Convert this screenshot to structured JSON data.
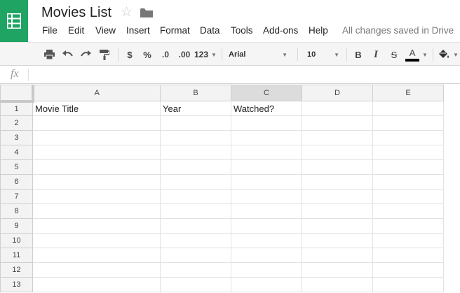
{
  "header": {
    "title": "Movies List",
    "save_status": "All changes saved in Drive",
    "menu": [
      "File",
      "Edit",
      "View",
      "Insert",
      "Format",
      "Data",
      "Tools",
      "Add-ons",
      "Help"
    ]
  },
  "toolbar": {
    "currency": "$",
    "percent": "%",
    "decrease_decimals": ".0",
    "increase_decimals": ".00",
    "more_formats": "123",
    "font": "Arial",
    "font_size": "10",
    "bold": "B",
    "italic": "I",
    "strikethrough": "S",
    "text_color": "A",
    "text_color_value": "#000000"
  },
  "formula_bar": {
    "label": "fx",
    "value": ""
  },
  "colors": {
    "brand_green": "#1fa463",
    "header_bg": "#f3f3f3",
    "selected_header_bg": "#dcdcdc"
  },
  "sheet": {
    "columns": [
      "A",
      "B",
      "C",
      "D",
      "E"
    ],
    "selected_column": "C",
    "rows": [
      {
        "num": "1",
        "cells": [
          "Movie Title",
          "Year",
          "Watched?",
          "",
          ""
        ]
      },
      {
        "num": "2",
        "cells": [
          "",
          "",
          "",
          "",
          ""
        ]
      },
      {
        "num": "3",
        "cells": [
          "",
          "",
          "",
          "",
          ""
        ]
      },
      {
        "num": "4",
        "cells": [
          "",
          "",
          "",
          "",
          ""
        ]
      },
      {
        "num": "5",
        "cells": [
          "",
          "",
          "",
          "",
          ""
        ]
      },
      {
        "num": "6",
        "cells": [
          "",
          "",
          "",
          "",
          ""
        ]
      },
      {
        "num": "7",
        "cells": [
          "",
          "",
          "",
          "",
          ""
        ]
      },
      {
        "num": "8",
        "cells": [
          "",
          "",
          "",
          "",
          ""
        ]
      },
      {
        "num": "9",
        "cells": [
          "",
          "",
          "",
          "",
          ""
        ]
      },
      {
        "num": "10",
        "cells": [
          "",
          "",
          "",
          "",
          ""
        ]
      },
      {
        "num": "11",
        "cells": [
          "",
          "",
          "",
          "",
          ""
        ]
      },
      {
        "num": "12",
        "cells": [
          "",
          "",
          "",
          "",
          ""
        ]
      },
      {
        "num": "13",
        "cells": [
          "",
          "",
          "",
          "",
          ""
        ]
      }
    ]
  }
}
